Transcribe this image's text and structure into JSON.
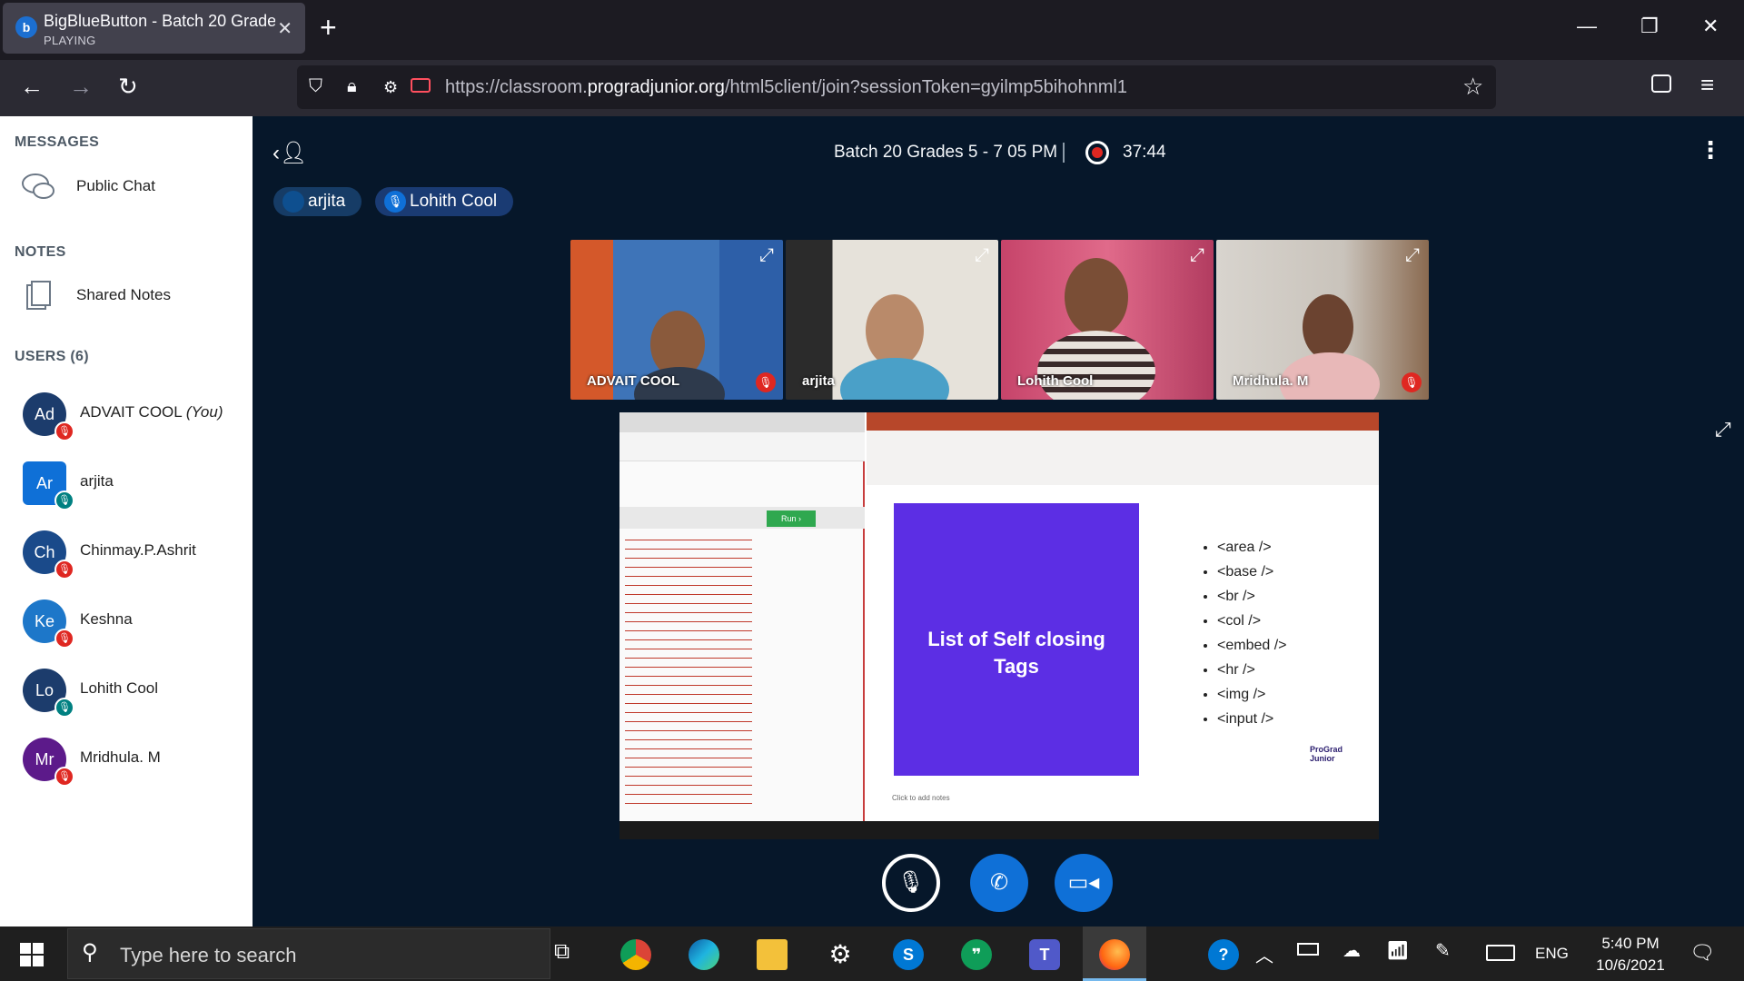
{
  "browser": {
    "tab_title": "BigBlueButton - Batch 20 Grade",
    "tab_status": "PLAYING",
    "url_prefix": "https://classroom.",
    "url_domain": "progradjunior.org",
    "url_path": "/html5client/join?sessionToken=gyilmp5bihohnml1"
  },
  "sidebar": {
    "messages_header": "MESSAGES",
    "public_chat": "Public Chat",
    "notes_header": "NOTES",
    "shared_notes": "Shared Notes",
    "users_header": "USERS (6)",
    "users": [
      {
        "initials": "Ad",
        "name": "ADVAIT COOL",
        "suffix": "(You)",
        "color": "#1c3c6c",
        "mic": "muted"
      },
      {
        "initials": "Ar",
        "name": "arjita",
        "suffix": "",
        "color": "#0f70d7",
        "mic": "on"
      },
      {
        "initials": "Ch",
        "name": "Chinmay.P.Ashrit",
        "suffix": "",
        "color": "#1a4a8a",
        "mic": "muted"
      },
      {
        "initials": "Ke",
        "name": "Keshna",
        "suffix": "",
        "color": "#1d77c9",
        "mic": "muted"
      },
      {
        "initials": "Lo",
        "name": "Lohith Cool",
        "suffix": "",
        "color": "#1c3c6c",
        "mic": "on"
      },
      {
        "initials": "Mr",
        "name": "Mridhula. M",
        "suffix": "",
        "color": "#5c1a8a",
        "mic": "muted"
      }
    ]
  },
  "meeting": {
    "title": "Batch 20 Grades 5 - 7 05 PM",
    "timer": "37:44",
    "talking": [
      "arjita",
      "Lohith Cool"
    ]
  },
  "videos": [
    {
      "label": "ADVAIT COOL",
      "muted": true,
      "bg": "#3e74b8",
      "skin": "#8a5a3c"
    },
    {
      "label": "arjita",
      "muted": false,
      "bg": "#d9d5cc",
      "skin": "#b98a6a"
    },
    {
      "label": "Lohith Cool",
      "muted": false,
      "bg": "#c6446a",
      "skin": "#7a4e36"
    },
    {
      "label": "Mridhula. M",
      "muted": true,
      "bg": "#c9c3bb",
      "skin": "#6b4330"
    }
  ],
  "share": {
    "slide_title": "List of Self closing Tags",
    "tags": [
      "<area />",
      "<base />",
      "<br />",
      "<col />",
      "<embed />",
      "<hr />",
      "<img />",
      "<input />"
    ],
    "run_label": "Run",
    "notes_placeholder": "Click to add notes",
    "brand": "ProGrad Junior"
  },
  "taskbar": {
    "search_placeholder": "Type here to search",
    "lang": "ENG",
    "time": "5:40 PM",
    "date": "10/6/2021"
  },
  "colors": {
    "bbb_dark": "#06172a",
    "bbb_blue": "#0f70d7",
    "muted_red": "#df2721",
    "slide_purple": "#5c2ee4"
  }
}
